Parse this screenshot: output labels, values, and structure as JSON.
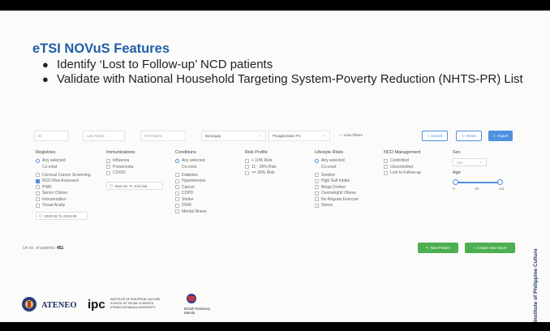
{
  "slide": {
    "title": "eTSI NOVuS Features",
    "bullets": [
      "Identify ‘Lost to Follow-up’ NCD patients",
      "Validate with National Household Targeting System-Poverty Reduction (NHTS-PR) List"
    ],
    "sidebar_text": "Institute of Philippine Culture"
  },
  "filters": {
    "id_placeholder": "ID",
    "last_name_placeholder": "Last Name",
    "first_name_placeholder": "First Name",
    "barangay_placeholder": "Barangay",
    "facility_value": "Pinagbuhatan PC",
    "less_filters": "— Less Filters",
    "search": "Search",
    "reset": "Reset",
    "export": "Export"
  },
  "registries": {
    "heading": "Registries",
    "any_selected": "Any selected",
    "co_exist": "Co-exist",
    "items": [
      {
        "label": "Cervical Cancer Screening",
        "checked": false
      },
      {
        "label": "NCD Risk Assessed",
        "checked": true
      },
      {
        "label": "PWD",
        "checked": false
      },
      {
        "label": "Senior Citizen",
        "checked": false
      },
      {
        "label": "Immunization",
        "checked": false
      },
      {
        "label": "Visual Acuity",
        "checked": false
      }
    ],
    "date_range": "2023-08 To 2023-08"
  },
  "immunizations": {
    "heading": "Immunizations",
    "items": [
      "Influenza",
      "Pneumonia",
      "COVID"
    ],
    "start_date": "Start da",
    "to": "To",
    "end_date": "End dat"
  },
  "conditions": {
    "heading": "Conditions",
    "any_selected": "Any selected",
    "co_exist": "Co-exist",
    "items": [
      "Diabetes",
      "Hypertension",
      "Cancer",
      "COPD",
      "Stroke",
      "DGM",
      "Mental Illness"
    ]
  },
  "risk_profile": {
    "heading": "Risk Profile",
    "items": [
      "< 10% Risk",
      "11 - 29% Risk",
      ">= 30% Risk"
    ]
  },
  "lifestyle": {
    "heading": "Lifestyle Risks",
    "any_selected": "Any selected",
    "co_exist": "Co-exist",
    "items": [
      "Smoker",
      "High Salt Intake",
      "Binge Drinker",
      "Overweight/ Obese",
      "No Regular Exercise",
      "Stress"
    ]
  },
  "ncd_management": {
    "heading": "NCD Management",
    "items": [
      "Controlled",
      "Uncontrolled",
      "Lost to Follow-up"
    ]
  },
  "sex": {
    "heading": "Sex",
    "placeholder": "Sex"
  },
  "age": {
    "heading": "Age",
    "min": "0",
    "mid": "50",
    "max": "111",
    "range_low": 0,
    "range_high": 111
  },
  "footer": {
    "patients_label": "Ue no. of patients:",
    "patients_count": "451",
    "new_patient": "New Patient",
    "new_report": "Create new report"
  },
  "logos": {
    "ateneo": "ATENEO",
    "ipc": "ipc",
    "ipc_text": "INSTITUTE OF PHILIPPINE CULTURE SCHOOL OF SOCIAL SCIENCES ATENEO DE MANILA UNIVERSITY",
    "british": "British Embassy Manila"
  },
  "colors": {
    "title": "#1f5fa8",
    "accent": "#4f8fe0",
    "green": "#4caf50"
  }
}
